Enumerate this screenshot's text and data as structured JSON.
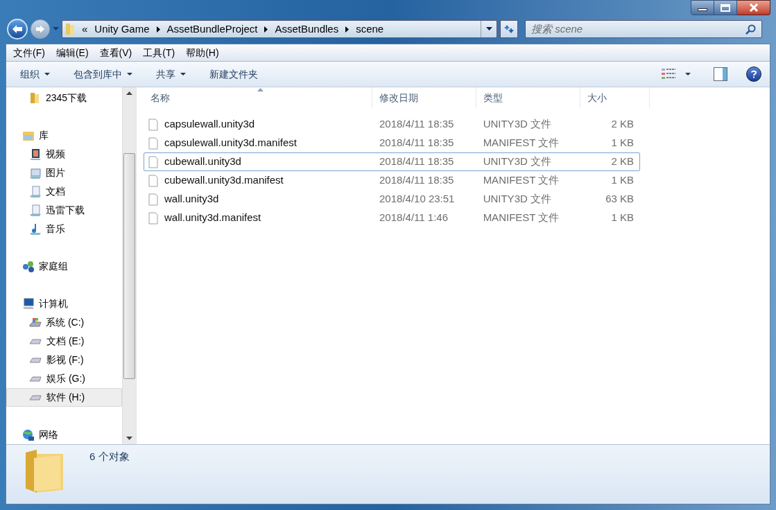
{
  "address": {
    "overflow": "«",
    "crumbs": [
      "Unity Game",
      "AssetBundleProject",
      "AssetBundles",
      "scene"
    ]
  },
  "search": {
    "placeholder": "搜索 scene"
  },
  "menu": [
    "文件(F)",
    "编辑(E)",
    "查看(V)",
    "工具(T)",
    "帮助(H)"
  ],
  "toolbar": [
    {
      "label": "组织",
      "dropdown": true
    },
    {
      "label": "包含到库中",
      "dropdown": true
    },
    {
      "label": "共享",
      "dropdown": true
    },
    {
      "label": "新建文件夹",
      "dropdown": false
    }
  ],
  "sidebar": {
    "sections": [
      {
        "children": [
          {
            "kind": "folder",
            "label": "2345下载",
            "selected": false
          }
        ]
      },
      {
        "kind": "library",
        "label": "库",
        "selected": false,
        "children": [
          {
            "kind": "video",
            "label": "视频",
            "selected": false
          },
          {
            "kind": "picture",
            "label": "图片",
            "selected": false
          },
          {
            "kind": "document",
            "label": "文档",
            "selected": false
          },
          {
            "kind": "document",
            "label": "迅雷下载",
            "selected": false
          },
          {
            "kind": "music",
            "label": "音乐",
            "selected": false
          }
        ]
      },
      {
        "kind": "homegroup",
        "label": "家庭组",
        "selected": false
      },
      {
        "kind": "computer",
        "label": "计算机",
        "selected": false,
        "children": [
          {
            "kind": "sysdrive",
            "label": "系统 (C:)",
            "selected": false
          },
          {
            "kind": "drive",
            "label": "文档 (E:)",
            "selected": false
          },
          {
            "kind": "drive",
            "label": "影视 (F:)",
            "selected": false
          },
          {
            "kind": "drive",
            "label": "娱乐 (G:)",
            "selected": false
          },
          {
            "kind": "drive",
            "label": "软件 (H:)",
            "selected": true
          }
        ]
      },
      {
        "kind": "network",
        "label": "网络",
        "selected": false
      }
    ]
  },
  "table": {
    "columns": [
      "名称",
      "修改日期",
      "类型",
      "大小"
    ],
    "rows": [
      {
        "name": "capsulewall.unity3d",
        "date": "2018/4/11 18:35",
        "type": "UNITY3D 文件",
        "size": "2 KB",
        "focused": false
      },
      {
        "name": "capsulewall.unity3d.manifest",
        "date": "2018/4/11 18:35",
        "type": "MANIFEST 文件",
        "size": "1 KB",
        "focused": false
      },
      {
        "name": "cubewall.unity3d",
        "date": "2018/4/11 18:35",
        "type": "UNITY3D 文件",
        "size": "2 KB",
        "focused": true
      },
      {
        "name": "cubewall.unity3d.manifest",
        "date": "2018/4/11 18:35",
        "type": "MANIFEST 文件",
        "size": "1 KB",
        "focused": false
      },
      {
        "name": "wall.unity3d",
        "date": "2018/4/10 23:51",
        "type": "UNITY3D 文件",
        "size": "63 KB",
        "focused": false
      },
      {
        "name": "wall.unity3d.manifest",
        "date": "2018/4/11 1:46",
        "type": "MANIFEST 文件",
        "size": "1 KB",
        "focused": false
      }
    ]
  },
  "status_bar": {
    "count": "6 个对象"
  }
}
